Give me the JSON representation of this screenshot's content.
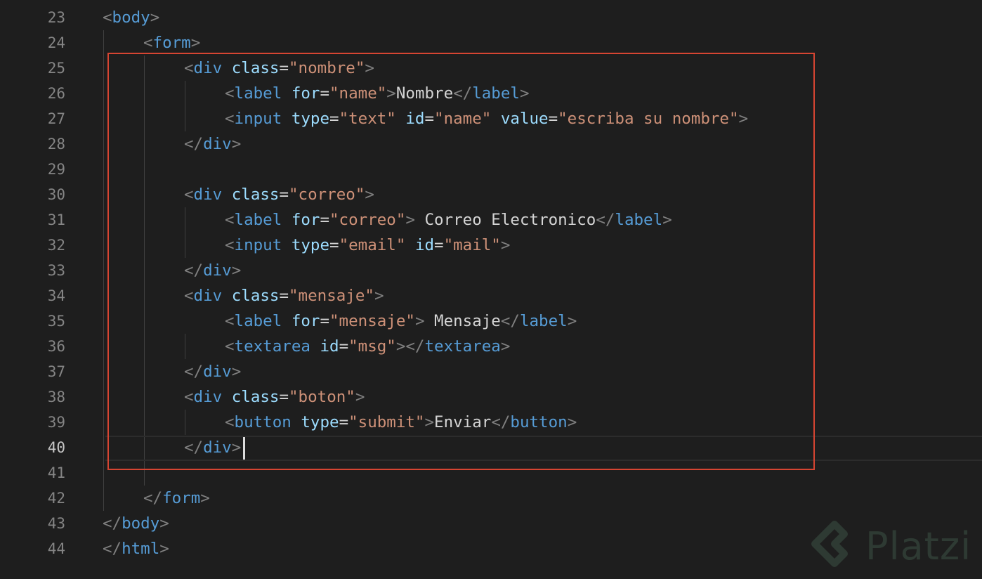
{
  "editor": {
    "active_line": "40",
    "lines": [
      {
        "num": "23",
        "p1": "<",
        "tag": "body",
        "p2": ">"
      },
      {
        "num": "24",
        "p1": "<",
        "tag": "form",
        "p2": ">"
      },
      {
        "num": "25",
        "p1": "<",
        "tag": "div",
        "sp1": " ",
        "attr1": "class",
        "eq1": "=",
        "val1": "\"nombre\"",
        "p2": ">"
      },
      {
        "num": "26",
        "p1": "<",
        "tag": "label",
        "sp1": " ",
        "attr1": "for",
        "eq1": "=",
        "val1": "\"name\"",
        "p2": ">",
        "text": "Nombre",
        "p3": "</",
        "tag2": "label",
        "p4": ">"
      },
      {
        "num": "27",
        "p1": "<",
        "tag": "input",
        "sp1": " ",
        "attr1": "type",
        "eq1": "=",
        "val1": "\"text\"",
        "sp2": " ",
        "attr2": "id",
        "eq2": "=",
        "val2": "\"name\"",
        "sp3": " ",
        "attr3": "value",
        "eq3": "=",
        "val3": "\"escriba su nombre\"",
        "p2": ">"
      },
      {
        "num": "28",
        "p1": "</",
        "tag": "div",
        "p2": ">"
      },
      {
        "num": "29"
      },
      {
        "num": "30",
        "p1": "<",
        "tag": "div",
        "sp1": " ",
        "attr1": "class",
        "eq1": "=",
        "val1": "\"correo\"",
        "p2": ">"
      },
      {
        "num": "31",
        "p1": "<",
        "tag": "label",
        "sp1": " ",
        "attr1": "for",
        "eq1": "=",
        "val1": "\"correo\"",
        "p2": ">",
        "text": " Correo Electronico",
        "p3": "</",
        "tag2": "label",
        "p4": ">"
      },
      {
        "num": "32",
        "p1": "<",
        "tag": "input",
        "sp1": " ",
        "attr1": "type",
        "eq1": "=",
        "val1": "\"email\"",
        "sp2": " ",
        "attr2": "id",
        "eq2": "=",
        "val2": "\"mail\"",
        "p2": ">"
      },
      {
        "num": "33",
        "p1": "</",
        "tag": "div",
        "p2": ">"
      },
      {
        "num": "34",
        "p1": "<",
        "tag": "div",
        "sp1": " ",
        "attr1": "class",
        "eq1": "=",
        "val1": "\"mensaje\"",
        "p2": ">"
      },
      {
        "num": "35",
        "p1": "<",
        "tag": "label",
        "sp1": " ",
        "attr1": "for",
        "eq1": "=",
        "val1": "\"mensaje\"",
        "p2": ">",
        "text": " Mensaje",
        "p3": "</",
        "tag2": "label",
        "p4": ">"
      },
      {
        "num": "36",
        "p1": "<",
        "tag": "textarea",
        "sp1": " ",
        "attr1": "id",
        "eq1": "=",
        "val1": "\"msg\"",
        "p2": ">",
        "p3": "</",
        "tag2": "textarea",
        "p4": ">"
      },
      {
        "num": "37",
        "p1": "</",
        "tag": "div",
        "p2": ">"
      },
      {
        "num": "38",
        "p1": "<",
        "tag": "div",
        "sp1": " ",
        "attr1": "class",
        "eq1": "=",
        "val1": "\"boton\"",
        "p2": ">"
      },
      {
        "num": "39",
        "p1": "<",
        "tag": "button",
        "sp1": " ",
        "attr1": "type",
        "eq1": "=",
        "val1": "\"submit\"",
        "p2": ">",
        "text": "Enviar",
        "p3": "</",
        "tag2": "button",
        "p4": ">"
      },
      {
        "num": "40",
        "p1": "</",
        "tag": "div",
        "p2": ">"
      },
      {
        "num": "41"
      },
      {
        "num": "42",
        "p1": "</",
        "tag": "form",
        "p2": ">"
      },
      {
        "num": "43",
        "p1": "</",
        "tag": "body",
        "p2": ">"
      },
      {
        "num": "44",
        "p1": "</",
        "tag": "html",
        "p2": ">"
      }
    ]
  },
  "colors": {
    "background": "#1e1e1e",
    "tag": "#569cd6",
    "attribute": "#9cdcfe",
    "string": "#ce9178",
    "punctuation": "#808080",
    "text": "#d4d4d4",
    "highlight_box": "#d64532"
  },
  "watermark": {
    "logo_icon": "platzi-logo-icon",
    "text": "Platzi"
  }
}
